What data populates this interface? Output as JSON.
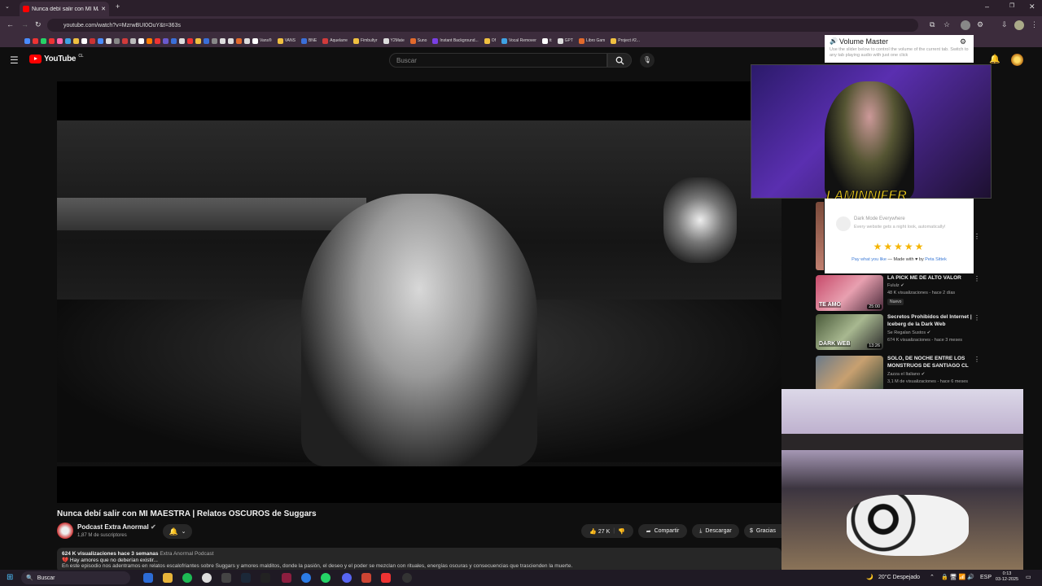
{
  "browser": {
    "tab_title": "Nunca debí salir con MI MA",
    "url": "youtube.com/watch?v=MzrwBUI0OuY&t=363s",
    "bookmarks": [
      {
        "label": "Vans®",
        "color": "#ffffff"
      },
      {
        "label": "VANS",
        "color": "#f0c040"
      },
      {
        "label": "BNE",
        "color": "#3a6fd8"
      },
      {
        "label": "Aquelarre",
        "color": "#d23b3b"
      },
      {
        "label": "Fimbultyr",
        "color": "#f0c040"
      },
      {
        "label": "Y2Mate",
        "color": "#dddddd"
      },
      {
        "label": "Suno",
        "color": "#e26a2c"
      },
      {
        "label": "Instant Background...",
        "color": "#7a3fe4"
      },
      {
        "label": "Of",
        "color": "#f0c040"
      },
      {
        "label": "Vocal Remover",
        "color": "#3fa2e4"
      },
      {
        "label": "tt",
        "color": "#ffffff"
      },
      {
        "label": "GPT",
        "color": "#dddddd"
      },
      {
        "label": "Libro Gam",
        "color": "#e26a2c"
      },
      {
        "label": "Project #2...",
        "color": "#f0c040"
      }
    ]
  },
  "youtube": {
    "logo_text": "YouTube",
    "logo_region": "CL",
    "search_placeholder": "Buscar",
    "video_title": "Nunca debí salir con MI MAESTRA | Relatos OSCUROS de Suggars",
    "channel_name": "Podcast Extra Anormal",
    "subscribers": "1,87 M de suscriptores",
    "likes": "27 K",
    "share_label": "Compartir",
    "download_label": "Descargar",
    "thanks_label": "Gracias",
    "desc_meta": "624 K visualizaciones  hace 3 semanas",
    "desc_channel": "Extra Anormal Podcast",
    "desc_line1": "Hay amores que no deberían existir...",
    "desc_line2": "En este episodio nos adentramos en relatos escalofriantes sobre Suggars y amores malditos, donde la pasión, el deseo y el poder se mezclan con rituales, energías oscuras y consecuencias que trascienden la muerte."
  },
  "volume_master": {
    "title": "Volume Master",
    "text": "Use the slider below to control the volume of the current tab. Switch to any tab playing audio with just one click"
  },
  "overlay": {
    "streamer_name": "LAMINNIFER"
  },
  "dark_mode": {
    "title": "Dark Mode Everywhere",
    "subtitle": "Every website gets a night look, automatically!",
    "stars": "★★★★★",
    "pay_text": "Pay what you like",
    "made_text": " — Made with ♥ by ",
    "author": "Peta Sittek"
  },
  "sidebar": [
    {
      "title": "LA PICK ME DE ALTO VALOR",
      "channel": "Fululz",
      "meta": "48 K visualizaciones - hace 2 días",
      "badge": "Nuevo",
      "duration": "25:00",
      "thumb_text": "TE AMO"
    },
    {
      "title": "Secretos Prohibidos del Internet | Iceberg de la Dark Web",
      "channel": "Se Regalan Sustos",
      "meta": "674 K visualizaciones - hace 3 meses",
      "badge": "",
      "duration": "13:26",
      "thumb_text": "DARK WEB"
    },
    {
      "title": "SOLO, DE NOCHE ENTRE LOS MONSTRUOS DE SANTIAGO CL",
      "channel": "Zazza el Italiano",
      "meta": "3,1 M de visualizaciones - hace 6 meses",
      "badge": "",
      "duration": "",
      "thumb_text": ""
    }
  ],
  "taskbar": {
    "search_placeholder": "Buscar",
    "weather": "20°C  Despejado",
    "lang": "ESP",
    "time": "0:13",
    "date": "03-12-2025"
  }
}
